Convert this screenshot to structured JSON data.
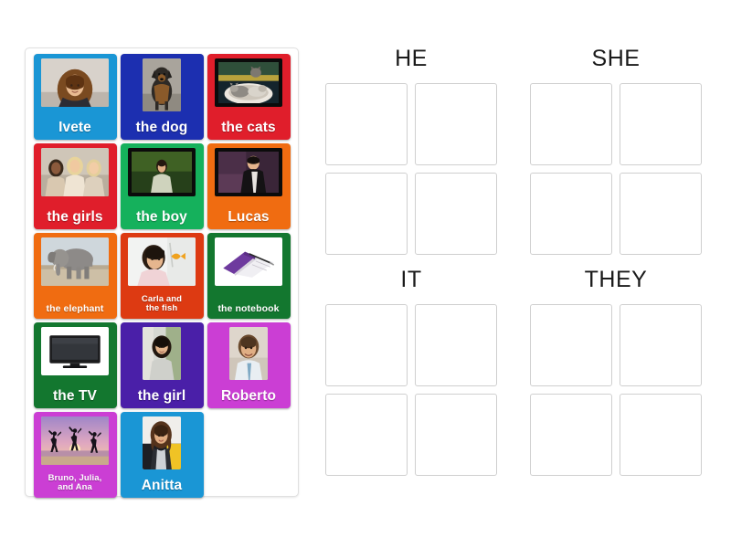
{
  "activity": {
    "type": "group-sort",
    "instruction_text": ""
  },
  "tray": {
    "name": "word-tile-tray",
    "tiles": [
      {
        "id": "ivete",
        "label": "Ivete",
        "bg": "#1a96d5",
        "image": "woman-portrait-ivete",
        "thumb": "landscape",
        "frame": "none",
        "label_size": "lg"
      },
      {
        "id": "the-dog",
        "label": "the dog",
        "bg": "#1c2fb0",
        "image": "dog-standing",
        "thumb": "portrait",
        "frame": "none",
        "label_size": "lg"
      },
      {
        "id": "the-cats",
        "label": "the cats",
        "bg": "#e01e2b",
        "image": "two-cats-in-bed",
        "thumb": "landscape",
        "frame": "black",
        "label_size": "lg"
      },
      {
        "id": "the-girls",
        "label": "the girls",
        "bg": "#e01e2b",
        "image": "three-girls-group",
        "thumb": "landscape",
        "frame": "none",
        "label_size": "lg"
      },
      {
        "id": "the-boy",
        "label": "the boy",
        "bg": "#15b15c",
        "image": "boy-outdoors",
        "thumb": "landscape",
        "frame": "black",
        "label_size": "lg"
      },
      {
        "id": "lucas",
        "label": "Lucas",
        "bg": "#f06c11",
        "image": "man-portrait-lucas",
        "thumb": "landscape",
        "frame": "black",
        "label_size": "lg"
      },
      {
        "id": "elephant",
        "label": "the elephant",
        "bg": "#f06c11",
        "image": "elephant-savanna",
        "thumb": "landscape",
        "frame": "none",
        "label_size": "sm"
      },
      {
        "id": "carla-fish",
        "label": "Carla and\nthe fish",
        "bg": "#dd3a12",
        "image": "girl-with-goldfish",
        "thumb": "landscape",
        "frame": "none",
        "label_size": "xs"
      },
      {
        "id": "notebook",
        "label": "the notebook",
        "bg": "#13772f",
        "image": "purple-notebook-with-pen",
        "thumb": "landscape",
        "frame": "white",
        "label_size": "sm"
      },
      {
        "id": "the-tv",
        "label": "the TV",
        "bg": "#13772f",
        "image": "flat-screen-tv",
        "thumb": "landscape",
        "frame": "white",
        "label_size": "lg"
      },
      {
        "id": "the-girl",
        "label": "the girl",
        "bg": "#4a1fa8",
        "image": "girl-portrait",
        "thumb": "portrait",
        "frame": "none",
        "label_size": "lg"
      },
      {
        "id": "roberto",
        "label": "Roberto",
        "bg": "#cb3ed4",
        "image": "man-portrait-roberto",
        "thumb": "portrait",
        "frame": "none",
        "label_size": "lg"
      },
      {
        "id": "bruno-etc",
        "label": "Bruno, Julia,\nand Ana",
        "bg": "#cb3ed4",
        "image": "three-people-jumping-beach",
        "thumb": "landscape",
        "frame": "none",
        "label_size": "xs"
      },
      {
        "id": "anitta",
        "label": "Anitta",
        "bg": "#1a96d5",
        "image": "woman-portrait-anitta",
        "thumb": "portrait",
        "frame": "none",
        "label_size": "lg"
      }
    ]
  },
  "categories": [
    {
      "id": "he",
      "title": "HE",
      "slots": 4
    },
    {
      "id": "she",
      "title": "SHE",
      "slots": 4
    },
    {
      "id": "it",
      "title": "IT",
      "slots": 4
    },
    {
      "id": "they",
      "title": "THEY",
      "slots": 4
    }
  ],
  "colors": {
    "slot_border": "#cfcfcf",
    "tray_border": "#e0e0e0",
    "title_text": "#1a1a1a",
    "tile_text": "#ffffff",
    "page_background": "#ffffff"
  }
}
